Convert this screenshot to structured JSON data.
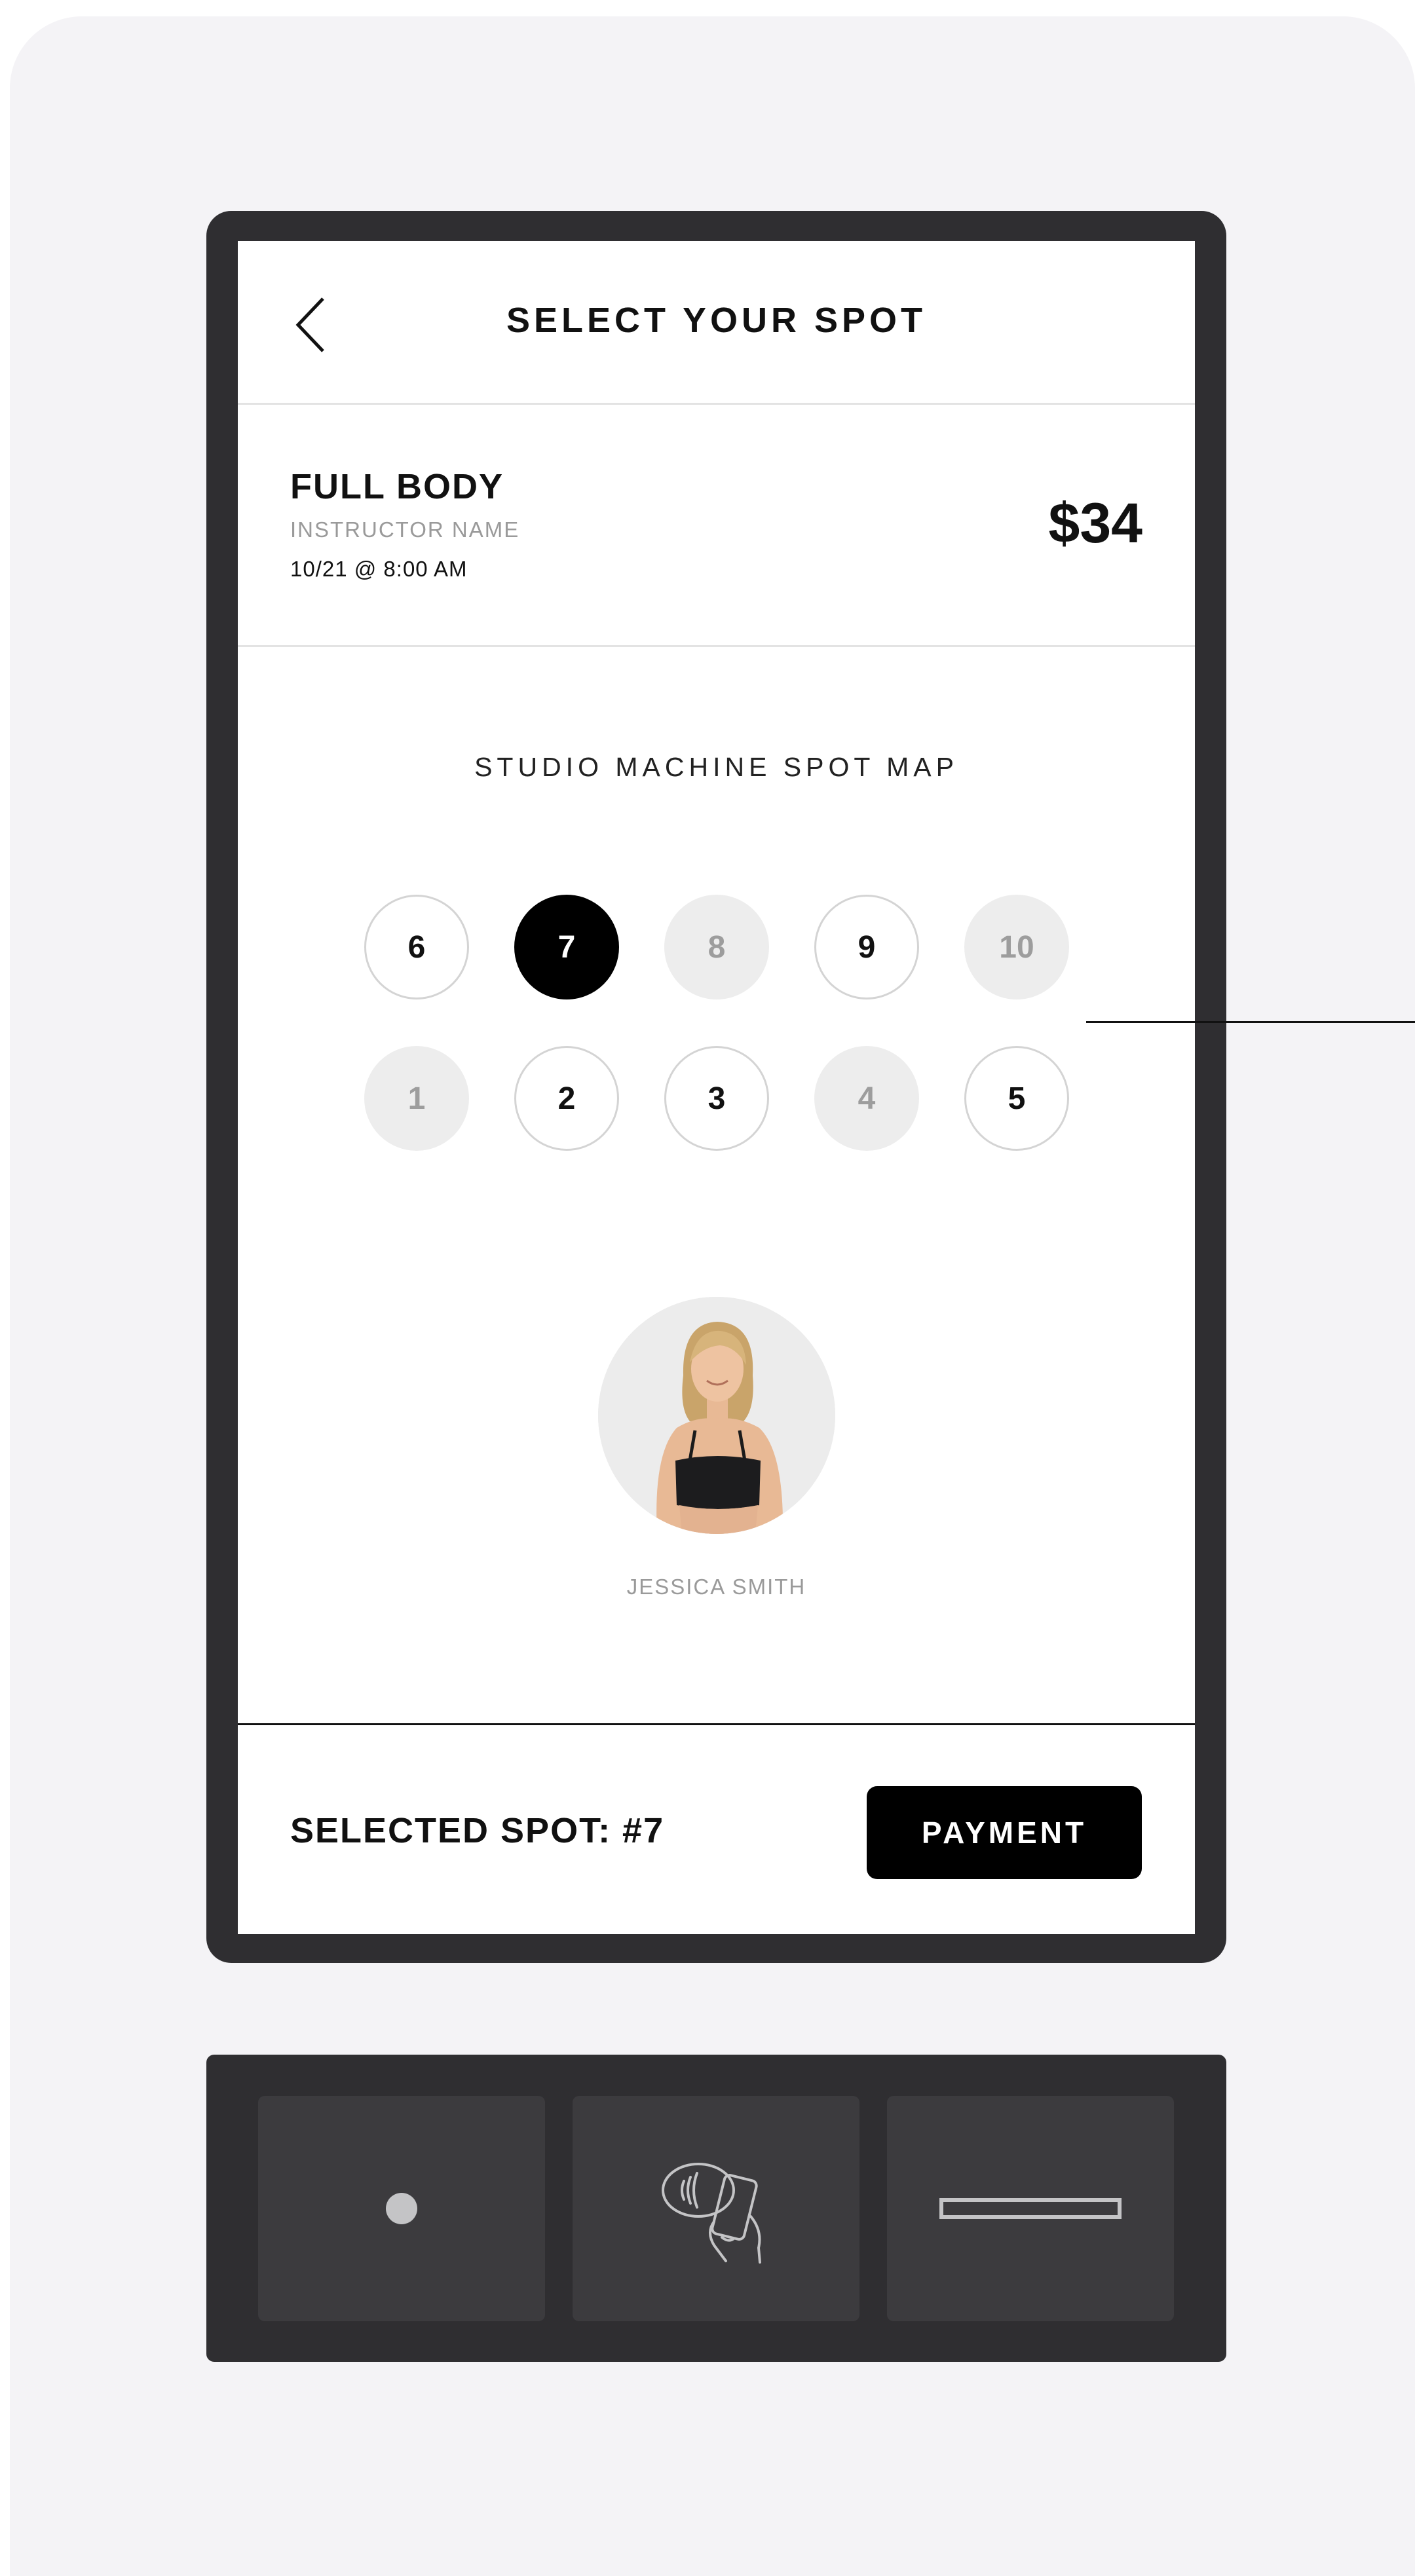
{
  "header": {
    "title": "SELECT YOUR SPOT",
    "back_icon": "chevron-left-icon"
  },
  "class_info": {
    "name": "FULL BODY",
    "instructor_label": "INSTRUCTOR NAME",
    "datetime": "10/21 @ 8:00 AM",
    "price": "$34"
  },
  "spot_map": {
    "title": "STUDIO MACHINE SPOT MAP",
    "rows": [
      [
        {
          "label": "6",
          "status": "open"
        },
        {
          "label": "7",
          "status": "selected"
        },
        {
          "label": "8",
          "status": "taken"
        },
        {
          "label": "9",
          "status": "open"
        },
        {
          "label": "10",
          "status": "taken"
        }
      ],
      [
        {
          "label": "1",
          "status": "taken"
        },
        {
          "label": "2",
          "status": "open"
        },
        {
          "label": "3",
          "status": "open"
        },
        {
          "label": "4",
          "status": "taken"
        },
        {
          "label": "5",
          "status": "open"
        }
      ]
    ],
    "instructor": {
      "name": "JESSICA SMITH",
      "photo_icon": "instructor-photo"
    }
  },
  "footer": {
    "selected_label": "SELECTED SPOT: #7",
    "payment_label": "PAYMENT"
  },
  "reader": {
    "slots": [
      "chip-reader-icon",
      "contactless-phone-icon",
      "card-swipe-slot-icon"
    ]
  },
  "colors": {
    "kiosk": "#2f2e31",
    "slot": "#3c3b3e",
    "selected": "#000000",
    "taken": "#ededed",
    "muted_text": "#9a9a9a",
    "backdrop": "#f4f3f6"
  }
}
